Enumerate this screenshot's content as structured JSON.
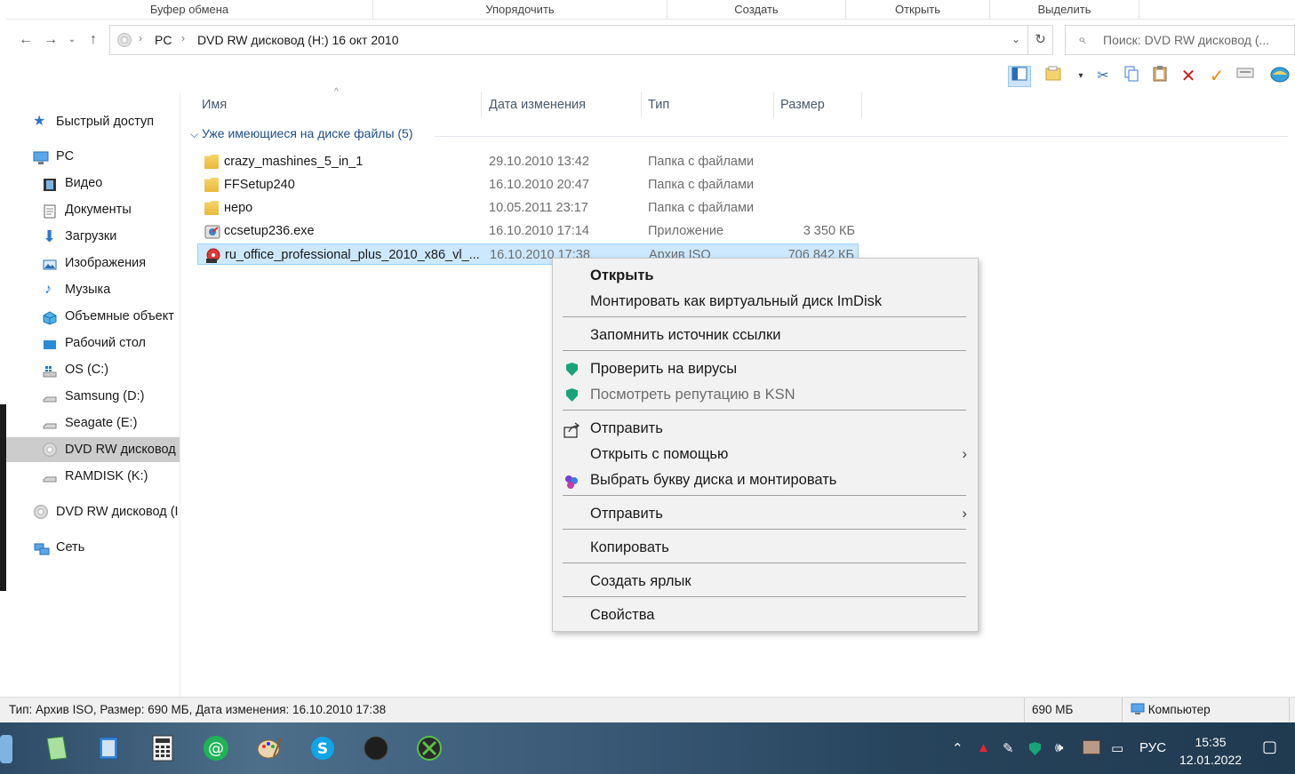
{
  "ribbon": {
    "groups": [
      "Буфер обмена",
      "Упорядочить",
      "Создать",
      "Открыть",
      "Выделить"
    ]
  },
  "address": {
    "crumbs": [
      "PC",
      "DVD RW дисковод (H:) 16 окт 2010"
    ],
    "search_placeholder": "Поиск: DVD RW дисковод (..."
  },
  "nav": {
    "items": [
      {
        "label": "Быстрый доступ",
        "icon": "star-icon"
      },
      {
        "label": "PC",
        "icon": "computer-icon"
      },
      {
        "label": "Видео",
        "icon": "video-icon"
      },
      {
        "label": "Документы",
        "icon": "documents-icon"
      },
      {
        "label": "Загрузки",
        "icon": "downloads-icon"
      },
      {
        "label": "Изображения",
        "icon": "pictures-icon"
      },
      {
        "label": "Музыка",
        "icon": "music-icon"
      },
      {
        "label": "Объемные объект",
        "icon": "3d-objects-icon"
      },
      {
        "label": "Рабочий стол",
        "icon": "desktop-icon"
      },
      {
        "label": "OS (C:)",
        "icon": "drive-icon"
      },
      {
        "label": "Samsung (D:)",
        "icon": "drive-icon"
      },
      {
        "label": "Seagate (E:)",
        "icon": "drive-icon"
      },
      {
        "label": "DVD RW дисковод",
        "icon": "dvd-icon"
      },
      {
        "label": "RAMDISK (K:)",
        "icon": "drive-icon"
      },
      {
        "label": "DVD RW дисковод (I",
        "icon": "dvd-icon"
      },
      {
        "label": "Сеть",
        "icon": "network-icon"
      }
    ]
  },
  "columns": {
    "name": "Имя",
    "date": "Дата изменения",
    "type": "Тип",
    "size": "Размер"
  },
  "group": {
    "title": "Уже имеющиеся на диске файлы (5)"
  },
  "files": [
    {
      "name": "crazy_mashines_5_in_1",
      "date": "29.10.2010 13:42",
      "type": "Папка с файлами",
      "size": ""
    },
    {
      "name": "FFSetup240",
      "date": "16.10.2010 20:47",
      "type": "Папка с файлами",
      "size": ""
    },
    {
      "name": "неро",
      "date": "10.05.2011 23:17",
      "type": "Папка с файлами",
      "size": ""
    },
    {
      "name": "ccsetup236.exe",
      "date": "16.10.2010 17:14",
      "type": "Приложение",
      "size": "3 350 КБ"
    },
    {
      "name": "ru_office_professional_plus_2010_x86_vl_...",
      "date": "16.10.2010 17:38",
      "type": "Архив ISO",
      "size": "706 842 КБ"
    }
  ],
  "context_menu": {
    "items": [
      {
        "label": "Открыть"
      },
      {
        "label": "Монтировать как виртуальный диск ImDisk"
      },
      {
        "label": "Запомнить источник ссылки"
      },
      {
        "label": "Проверить на вирусы"
      },
      {
        "label": "Посмотреть репутацию в KSN"
      },
      {
        "label": "Отправить"
      },
      {
        "label": "Открыть с помощью"
      },
      {
        "label": "Выбрать букву диска и монтировать"
      },
      {
        "label": "Отправить"
      },
      {
        "label": "Копировать"
      },
      {
        "label": "Создать ярлык"
      },
      {
        "label": "Свойства"
      }
    ]
  },
  "status": {
    "info": "Тип: Архив ISO, Размер: 690 МБ, Дата изменения: 16.10.2010 17:38",
    "size": "690 МБ",
    "location": "Компьютер"
  },
  "taskbar": {
    "lang": "РУС",
    "time": "15:35",
    "date": "12.01.2022"
  },
  "colors": {
    "selection": "#cce8ff",
    "accent_link": "#1e4e8c",
    "kaspersky_green": "#1aa37a"
  }
}
